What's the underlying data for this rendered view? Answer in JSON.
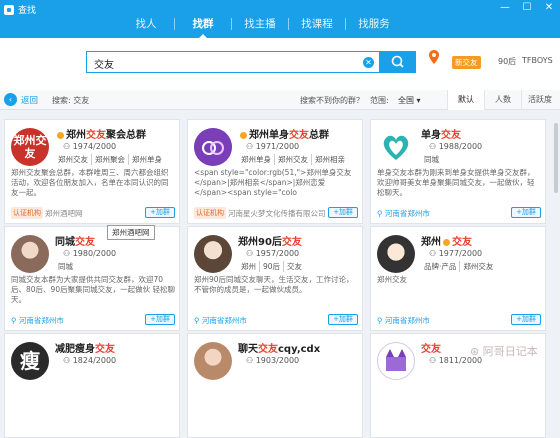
{
  "window": {
    "title": "查找",
    "controls": [
      "—",
      "☐",
      "✕"
    ]
  },
  "nav": {
    "tabs": [
      {
        "label": "找人",
        "active": false
      },
      {
        "label": "找群",
        "active": true
      },
      {
        "label": "找主播",
        "active": false
      },
      {
        "label": "找课程",
        "active": false
      },
      {
        "label": "找服务",
        "active": false
      }
    ]
  },
  "search": {
    "value": "交友",
    "hot_badge": "新交友",
    "hot_links": [
      "90后",
      "TFBOYS"
    ]
  },
  "filter": {
    "back_label": "返回",
    "search_label": "搜索: 交友",
    "find_more": "搜索不到你的群？",
    "range_label": "范围:",
    "range_value": "全国",
    "sort_tabs": [
      {
        "label": "默认",
        "active": true
      },
      {
        "label": "人数",
        "active": false
      },
      {
        "label": "活跃度",
        "active": false
      }
    ]
  },
  "cards": [
    {
      "avatar_text": "郑州交友",
      "name_prefix": "郑州",
      "name_hl": "交友",
      "name_suffix": "聚会总群",
      "members": "1974/2000",
      "tags": [
        "郑州交友",
        "郑州聚会",
        "郑州单身"
      ],
      "desc": "郑州交友聚会总群，本群唯周三、周六都会组织活动，欢迎各位朋友加入，名单在本同认识的同友一起。",
      "cert": "认证机构",
      "footer": "郑州酒吧网",
      "add": "+加群"
    },
    {
      "avatar_text": "",
      "name_prefix": "郑州单身",
      "name_hl": "交友",
      "name_suffix": "总群",
      "members": "1971/2000",
      "tags": [
        "郑州单身",
        "郑州交友",
        "郑州相亲"
      ],
      "desc": "<span style=\"color:rgb(51,\">郑州单身交友</span>|郑州相亲</span>|郑州恋爱</span><span style=\"colo",
      "cert": "认证机构",
      "footer": "河南星火梦文化传播有限公司",
      "add": "+加群"
    },
    {
      "avatar_text": "",
      "name_prefix": "单身",
      "name_hl": "交友",
      "name_suffix": "",
      "members": "1988/2000",
      "tags": [
        "同城"
      ],
      "desc": "单身交友本群为刚来到单身女提供单身交友群，欢迎帅哥美女单身聚集同城交友，一起做伙，轻松聊天。",
      "cert": "",
      "footer": "河南省郑州市",
      "add": "+加群"
    },
    {
      "avatar_text": "",
      "name_prefix": "同城",
      "name_hl": "交友",
      "name_suffix": "",
      "members": "1980/2000",
      "tags": [
        "同城"
      ],
      "desc": "同城交友本群为大家提供共同交友群，欢迎70后、80后、90后聚集同城交友，一起做伙 轻松聊天。",
      "cert": "",
      "footer": "河南省郑州市",
      "add": "+加群"
    },
    {
      "avatar_text": "",
      "name_prefix": "郑州90后",
      "name_hl": "交友",
      "name_suffix": "",
      "members": "1957/2000",
      "tags": [
        "郑州",
        "90后",
        "交友"
      ],
      "desc": "郑州90后同城交友聊天，生活交友，工作讨论，不管你的成员是，一起做伙成员。",
      "cert": "",
      "footer": "河南省郑州市",
      "add": "+加群"
    },
    {
      "avatar_text": "",
      "name_prefix": "郑州",
      "name_hl": "交友",
      "name_suffix": "",
      "members": "1977/2000",
      "tags": [
        "品牌·产品",
        "郑州交友"
      ],
      "desc": "郑州交友",
      "cert": "",
      "footer": "河南省郑州市",
      "add": "+加群"
    },
    {
      "avatar_text": "瘦",
      "name_prefix": "减肥瘦身",
      "name_hl": "交友",
      "name_suffix": "",
      "members": "1824/2000",
      "tags": [],
      "desc": "",
      "cert": "",
      "footer": "",
      "add": ""
    },
    {
      "avatar_text": "",
      "name_prefix": "聊天",
      "name_hl": "交友",
      "name_suffix": "cqy,cdx",
      "members": "1903/2000",
      "tags": [],
      "desc": "",
      "cert": "",
      "footer": "",
      "add": ""
    },
    {
      "avatar_text": "",
      "name_prefix": "",
      "name_hl": "交友",
      "name_suffix": "",
      "members": "1811/2000",
      "tags": [],
      "desc": "",
      "cert": "",
      "footer": "",
      "add": ""
    }
  ],
  "tooltip": "郑州酒吧网",
  "watermark": "⊛ 阿哥日记本",
  "colors": {
    "brand_blue": "#1aa0e8",
    "highlight_red": "#e8412c",
    "badge_orange": "#f59b23"
  }
}
